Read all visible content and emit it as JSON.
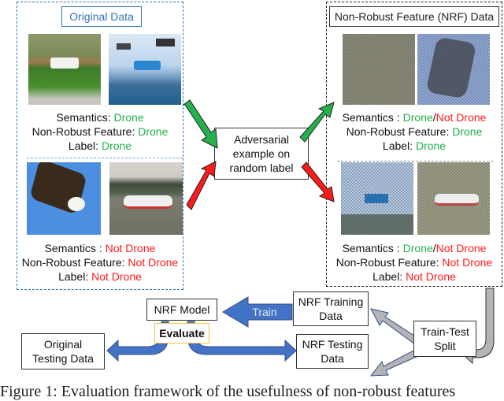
{
  "original_panel": {
    "title": "Original Data",
    "drone_group": {
      "images": [
        "drone-on-lawn-photo",
        "drones-over-sea-cliff-photo"
      ],
      "semantics_label": "Semantics: ",
      "semantics_value": "Drone",
      "nrf_label": "Non-Robust Feature: ",
      "nrf_value": "Drone",
      "label_label": "Label: ",
      "label_value": "Drone"
    },
    "not_drone_group": {
      "images": [
        "bald-eagle-photo",
        "airplane-on-runway-photo"
      ],
      "semantics_label": "Semantics : ",
      "semantics_value": "Not Drone",
      "nrf_label": "Non-Robust Feature: ",
      "nrf_value": "Not Drone",
      "label_label": "Label: ",
      "label_value": "Not Drone"
    }
  },
  "adversarial_box": {
    "line1": "Adversarial",
    "line2": "example on",
    "line3": "random label"
  },
  "nrf_panel": {
    "title": "Non-Robust Feature (NRF) Data",
    "drone_group": {
      "images": [
        "noisy-drone-lawn-photo",
        "noisy-eagle-photo"
      ],
      "semantics_label": "Semantics : ",
      "semantics_value_a": "Drone",
      "semantics_slash": "/",
      "semantics_value_b": "Not Drone",
      "nrf_label": "Non-Robust Feature: ",
      "nrf_value": "Drone",
      "label_label": "Label: ",
      "label_value": "Drone"
    },
    "not_drone_group": {
      "images": [
        "noisy-drones-sea-photo",
        "noisy-airplane-photo"
      ],
      "semantics_label": "Semantics : ",
      "semantics_value_a": "Drone",
      "semantics_slash": "/",
      "semantics_value_b": "Not Drone",
      "nrf_label": "Non-Robust Feature: ",
      "nrf_value": "Not Drone",
      "label_label": "Label: ",
      "label_value": "Not Drone"
    }
  },
  "flow": {
    "nrf_model": "NRF Model",
    "train_label": "Train",
    "evaluate_label": "Evaluate",
    "nrf_training_line1": "NRF Training",
    "nrf_training_line2": "Data",
    "nrf_testing_line1": "NRF Testing",
    "nrf_testing_line2": "Data",
    "train_test_line1": "Train-Test",
    "train_test_line2": "Split",
    "original_testing_line1": "Original",
    "original_testing_line2": "Testing Data"
  },
  "caption": "Figure 1: Evaluation framework of the usefulness of non-robust features",
  "colors": {
    "positive": "#22b14c",
    "negative": "#ff1a1a",
    "blue_arrow": "#4472c4",
    "gray_arrow": "#b4b4b4",
    "panel_border_blue": "#2e75b6",
    "evaluate_border": "#f6c344"
  }
}
